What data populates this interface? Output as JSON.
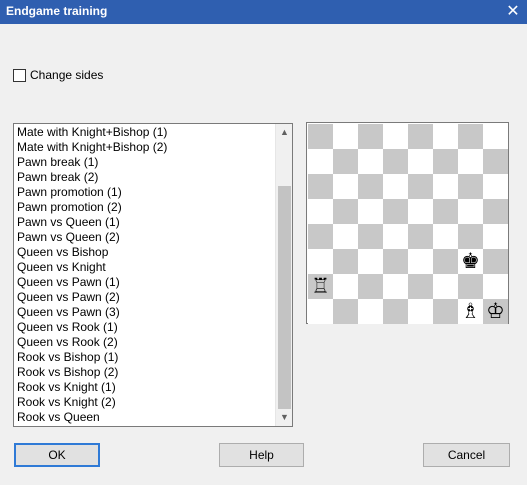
{
  "window": {
    "title": "Endgame training",
    "close_glyph": "✕"
  },
  "options": {
    "change_sides_label": "Change sides",
    "change_sides_checked": false
  },
  "exercise_list": {
    "items": [
      "Mate with Knight+Bishop (1)",
      "Mate with Knight+Bishop (2)",
      "Pawn break (1)",
      "Pawn break (2)",
      "Pawn promotion (1)",
      "Pawn promotion (2)",
      "Pawn vs Queen (1)",
      "Pawn vs Queen (2)",
      "Queen vs Bishop",
      "Queen vs Knight",
      "Queen vs Pawn (1)",
      "Queen vs Pawn (2)",
      "Queen vs Pawn (3)",
      "Queen vs Rook (1)",
      "Queen vs Rook (2)",
      "Rook vs Bishop (1)",
      "Rook vs Bishop (2)",
      "Rook vs Knight (1)",
      "Rook vs Knight (2)",
      "Rook vs Queen"
    ],
    "scroll_up_icon": "chevron-up-icon",
    "scroll_down_icon": "chevron-down-icon"
  },
  "board": {
    "colors": {
      "light": "#ffffff",
      "dark": "#c8c8c8"
    },
    "pieces": [
      {
        "square": "g3",
        "piece": "black-king",
        "glyph": "♚"
      },
      {
        "square": "a2",
        "piece": "white-rook",
        "glyph": "♖"
      },
      {
        "square": "g1",
        "piece": "white-bishop",
        "glyph": "♗"
      },
      {
        "square": "h1",
        "piece": "white-king",
        "glyph": "♔"
      }
    ]
  },
  "buttons": {
    "ok": "OK",
    "help": "Help",
    "cancel": "Cancel"
  },
  "colors": {
    "titlebar": "#2f5fb0",
    "default_button_border": "#2f7ad6"
  }
}
